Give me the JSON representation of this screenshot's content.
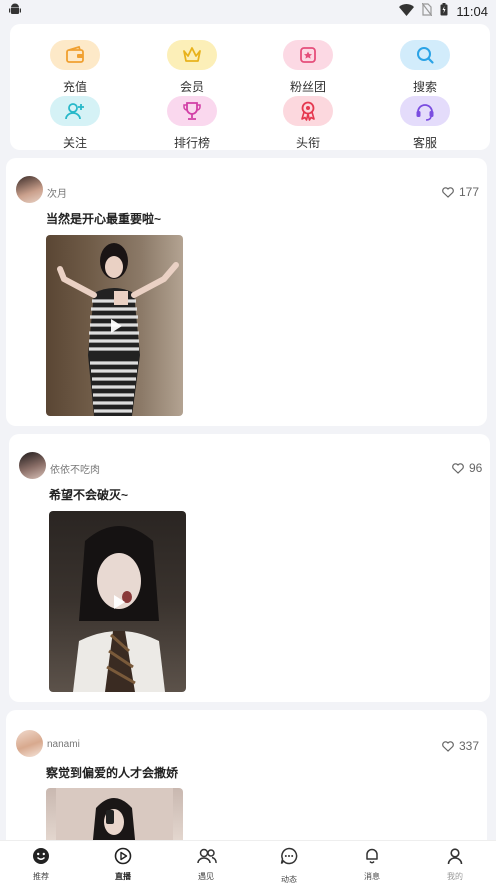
{
  "status_bar": {
    "time": "11:04"
  },
  "quick_menu": [
    {
      "label": "充值",
      "icon": "wallet-icon",
      "bg": "#fde9c8",
      "color": "#f0a030"
    },
    {
      "label": "会员",
      "icon": "crown-icon",
      "bg": "#fcefb8",
      "color": "#e8b21c"
    },
    {
      "label": "粉丝团",
      "icon": "flag-icon",
      "bg": "#fcd9e4",
      "color": "#e54e7b"
    },
    {
      "label": "搜索",
      "icon": "search-icon",
      "bg": "#d2ecfb",
      "color": "#2aa3e6"
    },
    {
      "label": "关注",
      "icon": "add-user-icon",
      "bg": "#d5f2f6",
      "color": "#27b8c9"
    },
    {
      "label": "排行榜",
      "icon": "trophy-icon",
      "bg": "#fad8ee",
      "color": "#d23fa6"
    },
    {
      "label": "头衔",
      "icon": "badge-icon",
      "bg": "#fcd8de",
      "color": "#e5384f"
    },
    {
      "label": "客服",
      "icon": "headset-icon",
      "bg": "#e4dcfb",
      "color": "#7a4de0"
    }
  ],
  "posts": [
    {
      "username": "次月",
      "likes": "177",
      "title": "当然是开心最重要啦~"
    },
    {
      "username": "依依不吃肉",
      "likes": "96",
      "title": "希望不会破灭~"
    },
    {
      "username": "nanami",
      "likes": "337",
      "title": "察觉到偏爱的人才会撒娇"
    }
  ],
  "tabs": [
    {
      "label": "推荐",
      "icon": "smiley-icon"
    },
    {
      "label": "直播",
      "icon": "play-circle-icon"
    },
    {
      "label": "遇见",
      "icon": "people-icon"
    },
    {
      "label": "动态",
      "icon": "chat-icon"
    },
    {
      "label": "消息",
      "icon": "bell-icon"
    },
    {
      "label": "我的",
      "icon": "person-icon"
    }
  ],
  "colors": {
    "background": "#f2f3f7",
    "card": "#ffffff",
    "heart": "#666666"
  }
}
